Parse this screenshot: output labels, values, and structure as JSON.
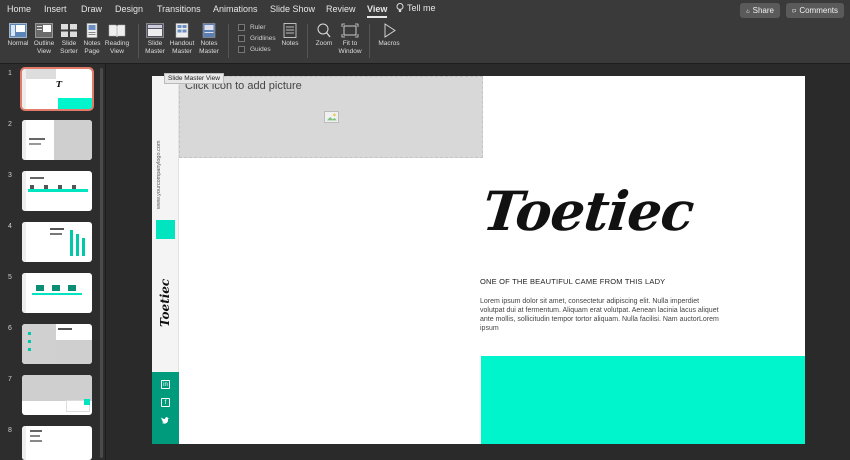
{
  "tabs": [
    {
      "label": "Home"
    },
    {
      "label": "Insert"
    },
    {
      "label": "Draw"
    },
    {
      "label": "Design"
    },
    {
      "label": "Transitions"
    },
    {
      "label": "Animations"
    },
    {
      "label": "Slide Show"
    },
    {
      "label": "Review"
    },
    {
      "label": "View"
    }
  ],
  "active_tab": "View",
  "tell_me": "Tell me",
  "share": "Share",
  "comments": "Comments",
  "ribbon": {
    "normal": "Normal",
    "outline_view": "Outline View",
    "slide_sorter": "Slide Sorter",
    "notes_page": "Notes Page",
    "reading_view": "Reading View",
    "slide_master": "Slide Master",
    "handout_master": "Handout Master",
    "notes_master": "Notes Master",
    "ruler": "Ruler",
    "gridlines": "Gridlines",
    "guides": "Guides",
    "notes": "Notes",
    "zoom": "Zoom",
    "fit_to_window": "Fit to Window",
    "macros": "Macros"
  },
  "tooltip": "Slide Master View",
  "slides": [
    {
      "number": "1",
      "selected": true
    },
    {
      "number": "2"
    },
    {
      "number": "3"
    },
    {
      "number": "4"
    },
    {
      "number": "5"
    },
    {
      "number": "6"
    },
    {
      "number": "7"
    },
    {
      "number": "8"
    }
  ],
  "slide": {
    "picture_placeholder": "Click icon to add picture",
    "url": "www.yourcompanylogo.com",
    "brand": "Toetiec",
    "tagline": "ONE OF THE BEAUTIFUL CAME FROM THIS LADY",
    "body": "Lorem ipsum dolor sit amet, consectetur adipiscing elit. Nulla imperdiet volutpat dui at fermentum. Aliquam erat volutpat. Aenean lacinia lacus aliquet ante mollis, sollicitudin tempor tortor aliquam. Nulla facilisi. Nam auctorLorem ipsum",
    "accent_color": "#00f5cc",
    "dark_accent_color": "#009b7d"
  }
}
